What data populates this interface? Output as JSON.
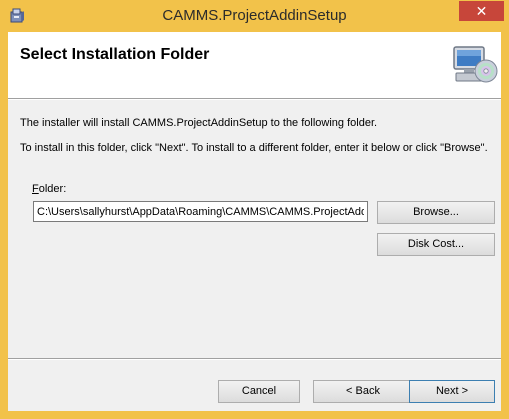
{
  "window": {
    "title": "CAMMS.ProjectAddinSetup",
    "close_glyph": "✕",
    "accent_color": "#f2c24a",
    "app_icon": "installer-package-icon"
  },
  "banner": {
    "title": "Select Installation Folder",
    "art_icon": "computer-with-disc-icon"
  },
  "body": {
    "line1": "The installer will install CAMMS.ProjectAddinSetup to the following folder.",
    "line2": "To install in this folder, click \"Next\". To install to a different folder, enter it below or click \"Browse\"."
  },
  "folder": {
    "label_mnemonic": "F",
    "label_rest": "older:",
    "value": "C:\\Users\\sallyhurst\\AppData\\Roaming\\CAMMS\\CAMMS.ProjectAdd"
  },
  "buttons": {
    "browse": "Browse...",
    "disk_cost": "Disk Cost...",
    "cancel": "Cancel",
    "back": "< Back",
    "next": "Next >"
  }
}
